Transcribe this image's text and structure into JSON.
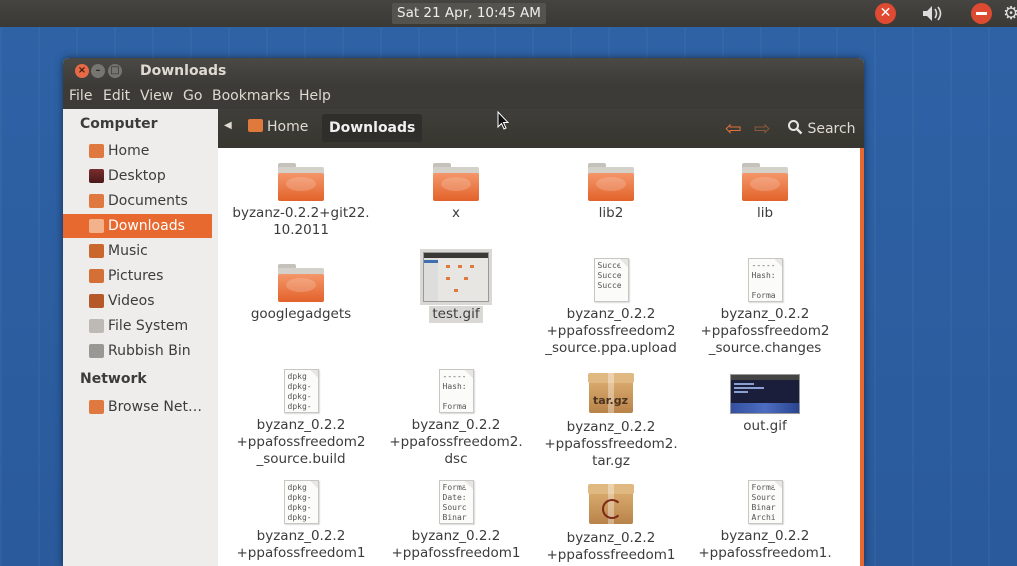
{
  "panel": {
    "clock": "Sat 21 Apr, 10:45 AM",
    "icons": [
      "close-tray-icon",
      "volume-icon",
      "power-icon",
      "gear-icon"
    ]
  },
  "window": {
    "title": "Downloads",
    "menu": [
      "File",
      "Edit",
      "View",
      "Go",
      "Bookmarks",
      "Help"
    ]
  },
  "sidebar": {
    "computer_heading": "Computer",
    "network_heading": "Network",
    "items": [
      {
        "label": "Home",
        "icon": "home-folder-icon"
      },
      {
        "label": "Desktop",
        "icon": "desktop-icon"
      },
      {
        "label": "Documents",
        "icon": "documents-folder-icon"
      },
      {
        "label": "Downloads",
        "icon": "downloads-folder-icon"
      },
      {
        "label": "Music",
        "icon": "music-folder-icon"
      },
      {
        "label": "Pictures",
        "icon": "pictures-folder-icon"
      },
      {
        "label": "Videos",
        "icon": "videos-folder-icon"
      },
      {
        "label": "File System",
        "icon": "harddisk-icon"
      },
      {
        "label": "Rubbish Bin",
        "icon": "trash-icon"
      }
    ],
    "network_items": [
      {
        "label": "Browse Net…",
        "icon": "network-icon"
      }
    ]
  },
  "toolbar": {
    "crumb_home": "Home",
    "crumb_current": "Downloads",
    "search": "Search"
  },
  "files": [
    {
      "name": "byzanz-0.2.2+git22.\n10.2011",
      "type": "folder"
    },
    {
      "name": "x",
      "type": "folder"
    },
    {
      "name": "lib2",
      "type": "folder"
    },
    {
      "name": "lib",
      "type": "folder"
    },
    {
      "name": "googlegadgets",
      "type": "folder"
    },
    {
      "name": "test.gif",
      "type": "image",
      "selected": true
    },
    {
      "name": "byzanz_0.2.2\n+ppafossfreedom2\n_source.ppa.upload",
      "type": "text",
      "preview": "Succe\nSucce\nSucce"
    },
    {
      "name": "byzanz_0.2.2\n+ppafossfreedom2\n_source.changes",
      "type": "text",
      "preview": "-----\nHash:\n\nForma"
    },
    {
      "name": "byzanz_0.2.2\n+ppafossfreedom2\n_source.build",
      "type": "text",
      "preview": "dpkg\ndpkg-\ndpkg-\ndpkg-"
    },
    {
      "name": "byzanz_0.2.2\n+ppafossfreedom2.\ndsc",
      "type": "text",
      "preview": "-----\nHash:\n\nForma"
    },
    {
      "name": "byzanz_0.2.2\n+ppafossfreedom2.\ntar.gz",
      "type": "archive",
      "badge": "tar.gz"
    },
    {
      "name": "out.gif",
      "type": "image2"
    },
    {
      "name": "byzanz_0.2.2\n+ppafossfreedom1",
      "type": "text",
      "preview": "dpkg\ndpkg-\ndpkg-\ndpkg-"
    },
    {
      "name": "byzanz_0.2.2\n+ppafossfreedom1",
      "type": "text",
      "preview": "Forma\nDate:\nSourc\nBinar"
    },
    {
      "name": "byzanz_0.2.2\n+ppafossfreedom1",
      "type": "deb"
    },
    {
      "name": "byzanz_0.2.2\n+ppafossfreedom1.",
      "type": "text",
      "preview": "Forma\nSourc\nBinar\nArchi"
    }
  ]
}
